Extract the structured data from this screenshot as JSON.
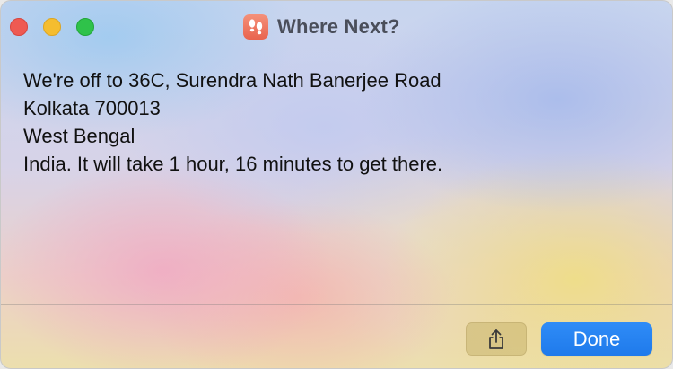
{
  "window": {
    "title": "Where Next?",
    "app_icon": "footprints-icon",
    "accent_color": "#1f7aeb"
  },
  "traffic_lights": {
    "close_color": "#ee5a52",
    "minimize_color": "#f5bd2f",
    "zoom_color": "#2fc24a"
  },
  "message": {
    "lines": [
      "We're off to 36C, Surendra Nath Banerjee Road",
      "Kolkata 700013",
      "West Bengal",
      "India. It will take 1 hour, 16 minutes to get there."
    ]
  },
  "buttons": {
    "share_icon": "share-icon",
    "done_label": "Done"
  }
}
